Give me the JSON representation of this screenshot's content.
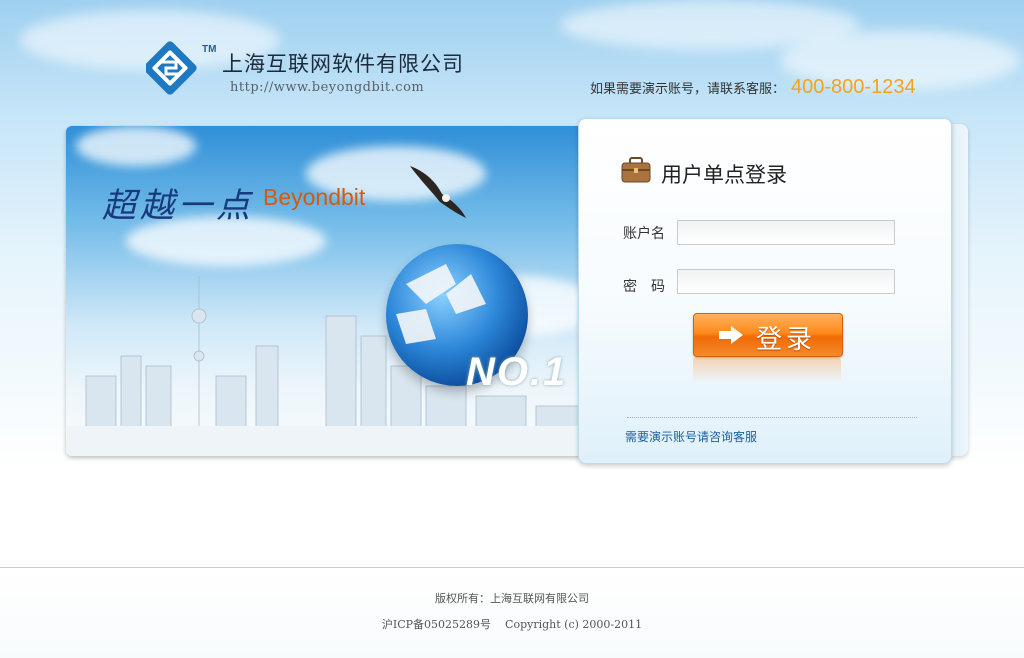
{
  "header": {
    "company_name": "上海互联网软件有限公司",
    "company_url": "http://www.beyongdbit.com",
    "logo_tm": "TM",
    "contact_text": "如果需要演示账号，请联系客服：",
    "contact_phone": "400-800-1234"
  },
  "banner": {
    "slogan": "超越一点",
    "brand": "Beyondbit",
    "badge": "NO.1"
  },
  "login": {
    "title": "用户单点登录",
    "username_label": "账户名",
    "password_label": "密　码",
    "username_value": "",
    "password_value": "",
    "submit_label": "登录",
    "help_link": "需要演示账号请咨询客服"
  },
  "footer": {
    "copyright_owner": "版权所有：上海互联网有限公司",
    "icp": "沪ICP备05025289号",
    "copyright": "Copyright (c) 2000-2011"
  },
  "colors": {
    "accent_phone": "#f7a21b",
    "login_button": "#ff8a1c",
    "link": "#1e5e9a",
    "brand_orange": "#d75a0a"
  }
}
